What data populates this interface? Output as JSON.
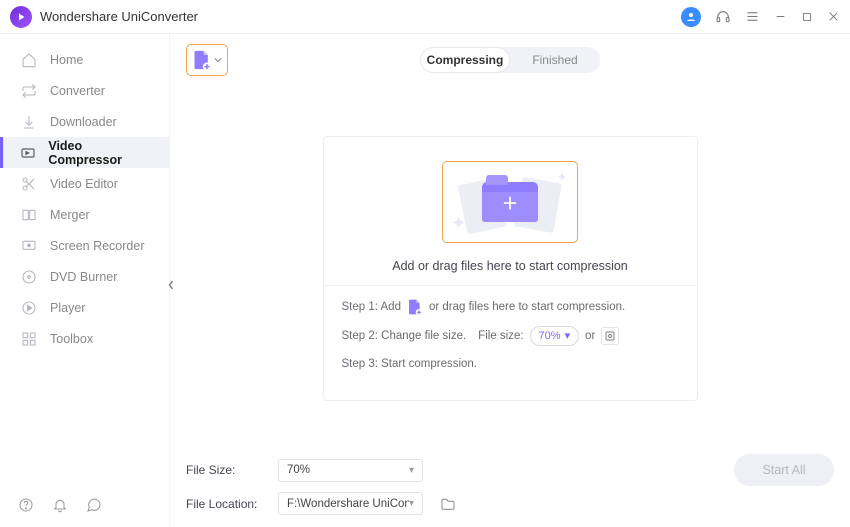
{
  "app": {
    "title": "Wondershare UniConverter"
  },
  "sidebar": {
    "items": [
      {
        "label": "Home"
      },
      {
        "label": "Converter"
      },
      {
        "label": "Downloader"
      },
      {
        "label": "Video Compressor"
      },
      {
        "label": "Video Editor"
      },
      {
        "label": "Merger"
      },
      {
        "label": "Screen Recorder"
      },
      {
        "label": "DVD Burner"
      },
      {
        "label": "Player"
      },
      {
        "label": "Toolbox"
      }
    ]
  },
  "tabs": {
    "compressing": "Compressing",
    "finished": "Finished"
  },
  "dropzone": {
    "caption": "Add or drag files here to start compression"
  },
  "steps": {
    "s1a": "Step 1: Add",
    "s1b": "or drag files here to start compression.",
    "s2a": "Step 2: Change file size.",
    "s2b": "File size:",
    "s2_pill": "70%",
    "s2_or": "or",
    "s3": "Step 3: Start compression."
  },
  "footer": {
    "size_label": "File Size:",
    "size_value": "70%",
    "location_label": "File Location:",
    "location_value": "F:\\Wondershare UniConverte",
    "start_all": "Start All"
  }
}
